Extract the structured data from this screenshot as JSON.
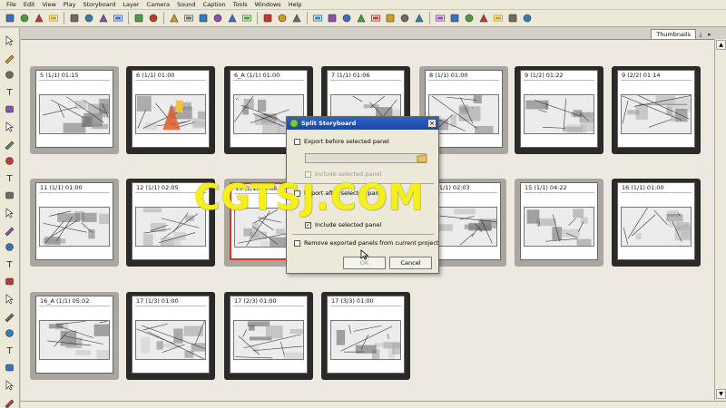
{
  "menu": [
    "File",
    "Edit",
    "View",
    "Play",
    "Storyboard",
    "Layer",
    "Camera",
    "Sound",
    "Caption",
    "Tools",
    "Windows",
    "Help"
  ],
  "toolbar_icons": [
    "new-icon",
    "open-icon",
    "save-icon",
    "print-icon",
    "cut-icon",
    "copy-icon",
    "paste-icon",
    "delete-icon",
    "undo-icon",
    "redo-icon",
    "view-icon",
    "thumbnails-icon",
    "grid-icon",
    "panel-icon",
    "stage-icon",
    "camera-icon",
    "zoom-in-icon",
    "zoom-out-icon",
    "reset-icon",
    "plugin-icon",
    "eye-icon",
    "onion-icon",
    "layer-icon",
    "pencil-icon",
    "insert-icon",
    "split-icon",
    "merge-icon",
    "first-icon",
    "prev-icon",
    "play-icon",
    "loop-icon",
    "sound-icon",
    "next-icon",
    "last-icon"
  ],
  "left_tool_icons": [
    "select-icon",
    "contour-icon",
    "brush-icon",
    "pencil-icon",
    "text-icon",
    "eraser-icon",
    "paint-icon",
    "ink-icon",
    "line-icon",
    "rectangle-icon",
    "ellipse-icon",
    "hand-icon",
    "transform-icon",
    "morph-icon",
    "pivot-icon",
    "camera-tool-icon",
    "keyframe-icon",
    "lock-icon",
    "unlock-icon",
    "sound-tool-icon",
    "paintbucket-icon",
    "zoom-tool-icon"
  ],
  "tab": {
    "label": "Thumbnails"
  },
  "panels": [
    {
      "label": "5 (1/1) 01:15",
      "style": "light"
    },
    {
      "label": "6 (1/1) 01:00",
      "style": "dark"
    },
    {
      "label": "6_A (1/1) 01:00",
      "style": "dark"
    },
    {
      "label": "7 (1/1) 01:06",
      "style": "dark"
    },
    {
      "label": "8 (1/1) 01:00",
      "style": "light"
    },
    {
      "label": "9 (1/2) 01:22",
      "style": "dark"
    },
    {
      "label": "9 (2/2) 01:14",
      "style": "dark"
    },
    {
      "label": "11 (1/1) 01:00",
      "style": "light"
    },
    {
      "label": "12 (1/1) 02:05",
      "style": "dark"
    },
    {
      "label": "13 (1/1) 02:06",
      "style": "selected"
    },
    {
      "label": "14 (1/1) 02:03",
      "style": "light"
    },
    {
      "label": "15 (1/1) 04:22",
      "style": "light"
    },
    {
      "label": "16 (1/1) 01:00",
      "style": "dark"
    },
    {
      "label": "16_A (1/1) 05:02",
      "style": "light"
    },
    {
      "label": "17 (1/3) 01:00",
      "style": "dark"
    },
    {
      "label": "17 (2/3) 01:00",
      "style": "dark"
    },
    {
      "label": "17 (3/3) 01:00",
      "style": "dark"
    }
  ],
  "dialog": {
    "title": "Split Storyboard",
    "export_before": "Export before selected panel",
    "include_selected_1": "Include selected panel",
    "export_after": "Export after selected panel",
    "include_selected_2": "Include selected panel",
    "remove_exported": "Remove exported panels from current project",
    "ok": "OK",
    "cancel": "Cancel",
    "check_mark": "✓",
    "close_glyph": "×"
  },
  "watermark": "CGTSJ.COM",
  "colors": {
    "accent": "#1b45a3",
    "watermark": "#f5ef1a",
    "selection": "#e0302a"
  }
}
